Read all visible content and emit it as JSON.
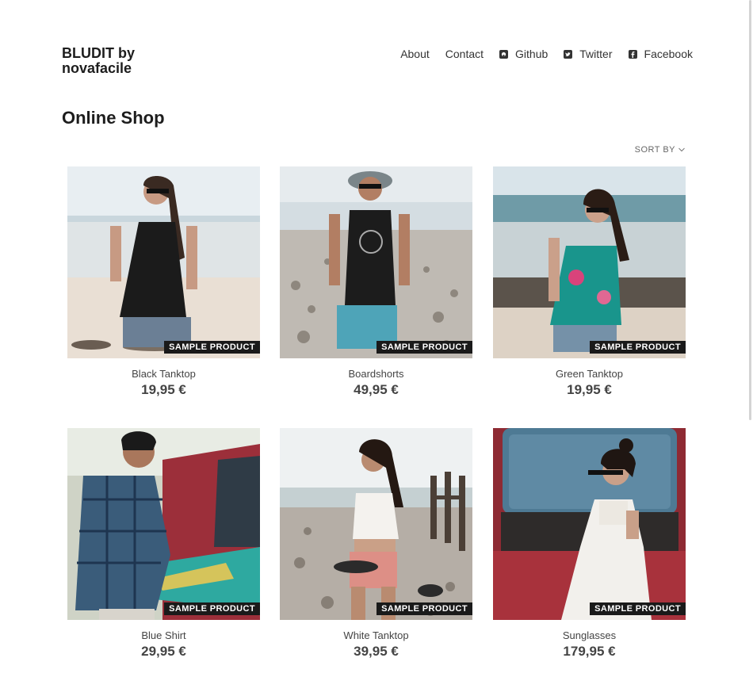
{
  "header": {
    "brand": "BLUDIT by novafacile",
    "nav": [
      {
        "label": "About",
        "icon": null
      },
      {
        "label": "Contact",
        "icon": null
      },
      {
        "label": "Github",
        "icon": "github-icon"
      },
      {
        "label": "Twitter",
        "icon": "twitter-icon"
      },
      {
        "label": "Facebook",
        "icon": "facebook-icon"
      }
    ]
  },
  "main": {
    "title": "Online Shop",
    "sort_label": "SORT BY",
    "badge_label": "SAMPLE PRODUCT",
    "products": [
      {
        "name": "Black Tanktop",
        "price": "19,95 €"
      },
      {
        "name": "Boardshorts",
        "price": "49,95 €"
      },
      {
        "name": "Green Tanktop",
        "price": "19,95 €"
      },
      {
        "name": "Blue Shirt",
        "price": "29,95 €"
      },
      {
        "name": "White Tanktop",
        "price": "39,95 €"
      },
      {
        "name": "Sunglasses",
        "price": "179,95 €"
      }
    ]
  }
}
